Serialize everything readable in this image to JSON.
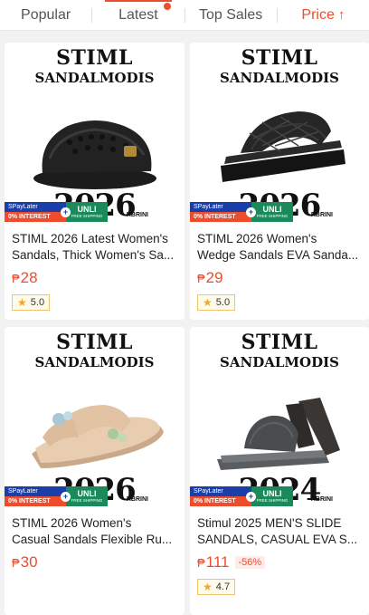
{
  "sort_tabs": [
    {
      "label": "Popular"
    },
    {
      "label": "Latest"
    },
    {
      "label": "Top Sales"
    },
    {
      "label": "Price"
    }
  ],
  "colors": {
    "accent": "#ee4d2d",
    "spaylater_blue": "#1a3fa8",
    "unli_green": "#1a8a5a"
  },
  "promo": {
    "spaylater": "SPayLater",
    "interest": "0% INTEREST",
    "unli": "UNLI",
    "free_shipping": "FREE SHIPPING",
    "rbrini": "RBRINI"
  },
  "products": [
    {
      "brand_line1": "STIML",
      "brand_line2": "SANDALMODIS",
      "year": "2026",
      "title_line1": "STIML 2026 Latest Women's",
      "title_line2": "Sandals, Thick Women's Sa...",
      "currency": "₱",
      "price": "28",
      "discount": "",
      "rating": "5.0"
    },
    {
      "brand_line1": "STIML",
      "brand_line2": "SANDALMODIS",
      "year": "2026",
      "title_line1": "STIML 2026 Women's",
      "title_line2": "Wedge Sandals EVA Sanda...",
      "currency": "₱",
      "price": "29",
      "discount": "",
      "rating": "5.0"
    },
    {
      "brand_line1": "STIML",
      "brand_line2": "SANDALMODIS",
      "year": "2026",
      "title_line1": "STIML 2026 Women's",
      "title_line2": "Casual Sandals Flexible Ru...",
      "currency": "₱",
      "price": "30",
      "discount": "",
      "rating": ""
    },
    {
      "brand_line1": "STIML",
      "brand_line2": "SANDALMODIS",
      "year": "2024",
      "title_line1": "Stimul 2025 MEN'S SLIDE",
      "title_line2": "SANDALS, CASUAL EVA S...",
      "currency": "₱",
      "price": "111",
      "discount": "-56%",
      "rating": "4.7"
    }
  ]
}
